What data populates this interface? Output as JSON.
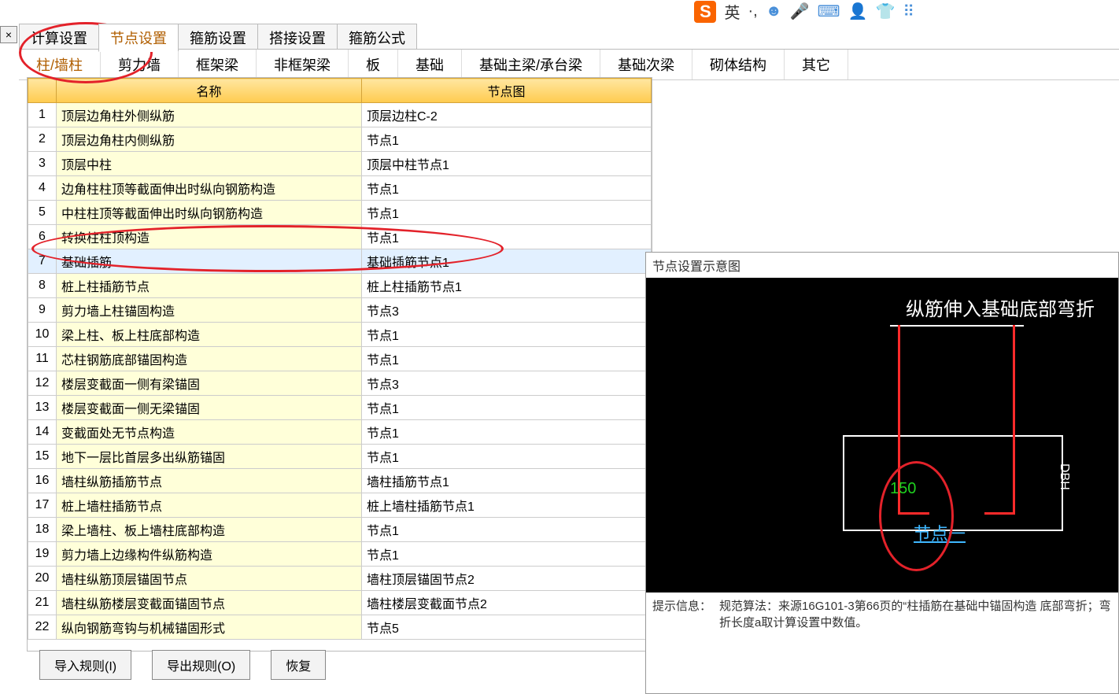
{
  "ime": {
    "lang": "英",
    "dots": "·,",
    "smile": "☻",
    "mic": "🎤",
    "kbd": "⌨",
    "person": "👤",
    "shirt": "👕",
    "grid": "⠿"
  },
  "tabs_main": [
    "计算设置",
    "节点设置",
    "箍筋设置",
    "搭接设置",
    "箍筋公式"
  ],
  "tabs_main_active": 1,
  "tabs_sub": [
    "柱/墙柱",
    "剪力墙",
    "框架梁",
    "非框架梁",
    "板",
    "基础",
    "基础主梁/承台梁",
    "基础次梁",
    "砌体结构",
    "其它"
  ],
  "tabs_sub_active": 0,
  "table_headers": [
    "",
    "名称",
    "节点图"
  ],
  "rows": [
    {
      "n": "1",
      "name": "顶层边角柱外侧纵筋",
      "node": "顶层边柱C-2"
    },
    {
      "n": "2",
      "name": "顶层边角柱内侧纵筋",
      "node": "节点1"
    },
    {
      "n": "3",
      "name": "顶层中柱",
      "node": "顶层中柱节点1"
    },
    {
      "n": "4",
      "name": "边角柱柱顶等截面伸出时纵向钢筋构造",
      "node": "节点1"
    },
    {
      "n": "5",
      "name": "中柱柱顶等截面伸出时纵向钢筋构造",
      "node": "节点1"
    },
    {
      "n": "6",
      "name": "转换柱柱顶构造",
      "node": "节点1"
    },
    {
      "n": "7",
      "name": "基础插筋",
      "node": "基础插筋节点1",
      "sel": true
    },
    {
      "n": "8",
      "name": "桩上柱插筋节点",
      "node": "桩上柱插筋节点1"
    },
    {
      "n": "9",
      "name": "剪力墙上柱锚固构造",
      "node": "节点3"
    },
    {
      "n": "10",
      "name": "梁上柱、板上柱底部构造",
      "node": "节点1"
    },
    {
      "n": "11",
      "name": "芯柱钢筋底部锚固构造",
      "node": "节点1"
    },
    {
      "n": "12",
      "name": "楼层变截面一侧有梁锚固",
      "node": "节点3"
    },
    {
      "n": "13",
      "name": "楼层变截面一侧无梁锚固",
      "node": "节点1"
    },
    {
      "n": "14",
      "name": "变截面处无节点构造",
      "node": "节点1"
    },
    {
      "n": "15",
      "name": "地下一层比首层多出纵筋锚固",
      "node": "节点1"
    },
    {
      "n": "16",
      "name": "墙柱纵筋插筋节点",
      "node": "墙柱插筋节点1"
    },
    {
      "n": "17",
      "name": "桩上墙柱插筋节点",
      "node": "桩上墙柱插筋节点1"
    },
    {
      "n": "18",
      "name": "梁上墙柱、板上墙柱底部构造",
      "node": "节点1"
    },
    {
      "n": "19",
      "name": "剪力墙上边缘构件纵筋构造",
      "node": "节点1"
    },
    {
      "n": "20",
      "name": "墙柱纵筋顶层锚固节点",
      "node": "墙柱顶层锚固节点2"
    },
    {
      "n": "21",
      "name": "墙柱纵筋楼层变截面锚固节点",
      "node": "墙柱楼层变截面节点2"
    },
    {
      "n": "22",
      "name": "纵向钢筋弯钩与机械锚固形式",
      "node": "节点5"
    }
  ],
  "btns": {
    "import": "导入规则(I)",
    "export": "导出规则(O)",
    "restore": "恢复"
  },
  "diagram": {
    "panel_title": "节点设置示意图",
    "title": "纵筋伸入基础底部弯折",
    "node_label": "节点一",
    "val150": "150",
    "dbh": "DBH",
    "hint_label": "提示信息：",
    "hint_text": "规范算法：来源16G101-3第66页的“柱插筋在基础中锚固构造 底部弯折；弯折长度a取计算设置中数值。"
  }
}
